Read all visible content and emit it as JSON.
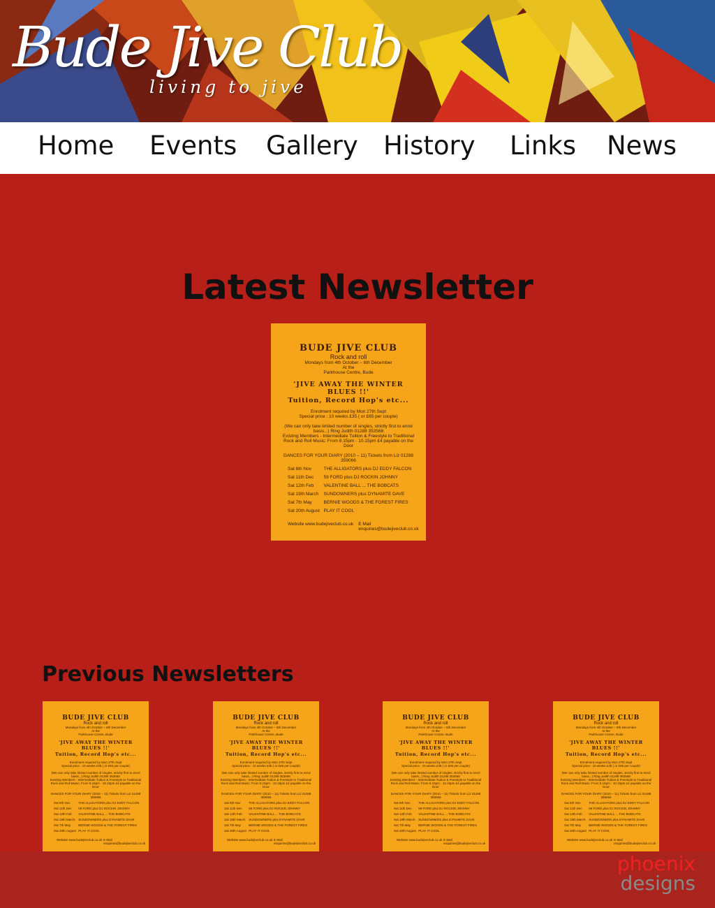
{
  "site": {
    "logo_text": "Bude Jive Club",
    "tagline": "living to jive"
  },
  "nav": {
    "items": [
      {
        "label": "Home"
      },
      {
        "label": "Events"
      },
      {
        "label": "Gallery"
      },
      {
        "label": "History"
      },
      {
        "label": "Links"
      },
      {
        "label": "News"
      }
    ]
  },
  "latest": {
    "title": "Latest Newsletter"
  },
  "flyer": {
    "club": "BUDE JIVE CLUB",
    "style": "Rock and roll",
    "dates": "Mondays from 4th October – 6th December",
    "at": "At the",
    "venue": "Parkhouse Centre, Bude",
    "headline": "'JIVE AWAY THE WINTER BLUES !!'",
    "tuition": "Tuition, Record Hop's etc...",
    "enrolment": "Enrolment required by Mon 27th Sept",
    "price": "Special price : 10 weeks £35 ( or £65 per couple)",
    "singles": "(We can only take limited number of singles, strictly first to enrol basis...) Ring Judith 01288 353568",
    "members": "Existing Members - Intermediate Tuition & Freestyle to Traditional Rock and Roll Music: From 8.15pm - 10.15pm £4 payable on the Door",
    "diary": "DANCES FOR YOUR DIARY (2010 – 11) Tickets from Liz 01288 359066",
    "dances": [
      {
        "date": "Sat 6th Nov",
        "act": "THE ALLIGATORS plus DJ EDDY FALCON"
      },
      {
        "date": "Sat 11th Dec",
        "act": "59 FORD plus DJ ROCKIN JOHNNY"
      },
      {
        "date": "Sat 12th Feb",
        "act": "VALENTINE BALL ... THE BOBCATS"
      },
      {
        "date": "Sat 19th March",
        "act": "SUNDOWNERS plus DYNAMITE DAVE"
      },
      {
        "date": "Sat 7th May",
        "act": "BERNIE WOODS & THE FOREST FIRES"
      },
      {
        "date": "Sat 20th August",
        "act": "PLAY IT COOL"
      }
    ],
    "website": "Website  www.budejiveclub.co.uk",
    "email": "E Mail  enquiries@budejiveclub.co.uk"
  },
  "previous": {
    "title": "Previous Newsletters",
    "count": 4
  },
  "footer": {
    "credit_line1": "phoenix",
    "credit_line2": "designs"
  },
  "colors": {
    "page_bg": "#b81f18",
    "flyer_bg": "#f6a41a",
    "credit_red": "#ee2222",
    "credit_grey": "#8a8a8a"
  }
}
